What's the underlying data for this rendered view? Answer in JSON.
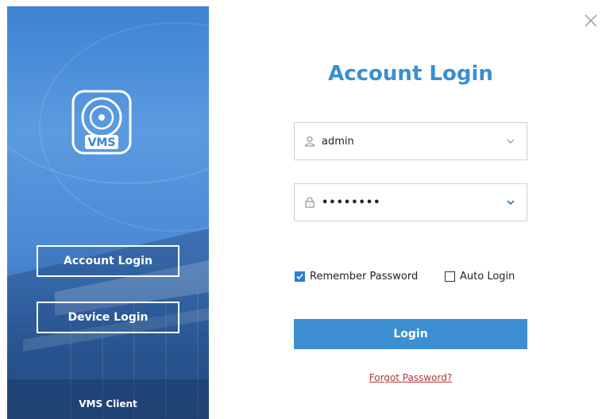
{
  "sidebar": {
    "logo_text": "VMS",
    "account_login_label": "Account Login",
    "device_login_label": "Device Login",
    "footer_label": "VMS Client"
  },
  "form": {
    "title": "Account Login",
    "username": {
      "value": "admin",
      "icon": "user-icon"
    },
    "password": {
      "value": "••••••••",
      "icon": "lock-icon"
    },
    "remember_password_label": "Remember Password",
    "remember_password_checked": true,
    "auto_login_label": "Auto Login",
    "auto_login_checked": false,
    "login_button_label": "Login",
    "forgot_password_label": "Forgot Password?"
  },
  "colors": {
    "accent": "#3d8fd1",
    "title": "#3a8fd0",
    "link": "#b0353a",
    "sidebar": "#3e82d2"
  }
}
